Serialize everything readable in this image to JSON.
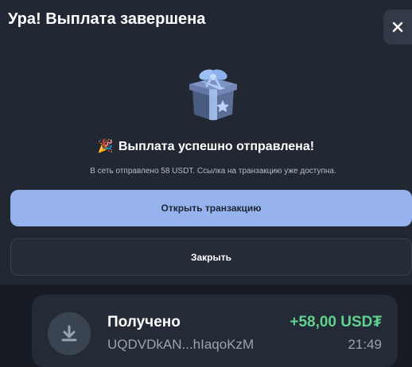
{
  "modal": {
    "title": "Ура! Выплата завершена",
    "headline_emoji": "🎉",
    "headline": "Выплата успешно отправлена!",
    "subtext": "В сеть отправлено 58 USDT. Ссылка на транзакцию уже доступна.",
    "primary_button": "Открыть транзакцию",
    "secondary_button": "Закрыть",
    "icons": {
      "close": "close-icon",
      "hero": "gift-box-icon"
    }
  },
  "transaction": {
    "title": "Получено",
    "address": "UQDVDkAN...hIaqoKzM",
    "amount": "+58,00 USD₮",
    "time": "21:49",
    "icon": "download-arrow-icon"
  },
  "colors": {
    "modal_bg": "#222833",
    "page_bg": "#161b24",
    "primary_button": "#97b3ee",
    "amount_green": "#5fd38d"
  }
}
